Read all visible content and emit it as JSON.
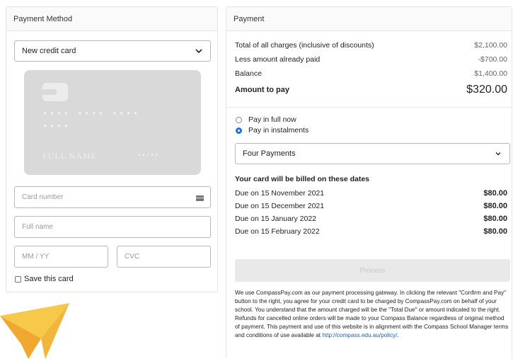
{
  "left_panel": {
    "title": "Payment Method",
    "method_select": "New credit card",
    "card_preview": {
      "number_line1": "•••• •••• ••••",
      "number_line2": "••••",
      "name": "FULL NAME",
      "expiry": "••/••"
    },
    "inputs": {
      "card_number_placeholder": "Card number",
      "full_name_placeholder": "Full name",
      "expiry_placeholder": "MM / YY",
      "cvc_placeholder": "CVC"
    },
    "save_card_label": "Save this card"
  },
  "right_panel": {
    "title": "Payment",
    "summary": [
      {
        "label": "Total of all charges (inclusive of discounts)",
        "value": "$2,100.00"
      },
      {
        "label": "Less amount already paid",
        "value": "-$700.00"
      },
      {
        "label": "Balance",
        "value": "$1,400.00"
      }
    ],
    "amount_to_pay": {
      "label": "Amount to pay",
      "value": "$320.00"
    },
    "options": [
      {
        "label": "Pay in full now",
        "selected": false
      },
      {
        "label": "Pay in instalments",
        "selected": true
      }
    ],
    "instalment_select": "Four Payments",
    "billing_title": "Your card will be billed on these dates",
    "schedule": [
      {
        "date": "Due on 15 November 2021",
        "amount": "$80.00"
      },
      {
        "date": "Due on 15 December 2021",
        "amount": "$80.00"
      },
      {
        "date": "Due on 15 January 2022",
        "amount": "$80.00"
      },
      {
        "date": "Due on 15 February 2022",
        "amount": "$80.00"
      }
    ],
    "process_button": "Process",
    "disclaimer_text": "We use CompassPay.com as our payment processing gateway. In clicking the relevant \"Confirm and Pay\" button to the right, you agree for your credit card to be charged by CompassPay.com on behalf of your school. You understand that the amount charged will be the \"Total Due\" or amount indicated to the right. Refunds for cancelled online orders will be made to your Compass Balance regardless of original method of payment. This payment and use of this website is in alignment with the Compass School Manager terms and conditions of use available at ",
    "disclaimer_link": "http://compass.edu.au/policy/",
    "disclaimer_end": "."
  },
  "colors": {
    "accent": "#1a73e8",
    "plane_light": "#f7c948",
    "plane_dark": "#f0a830"
  },
  "icons": [
    "chevron-down-icon",
    "card-type-icon",
    "chip-icon",
    "paper-plane-icon"
  ]
}
